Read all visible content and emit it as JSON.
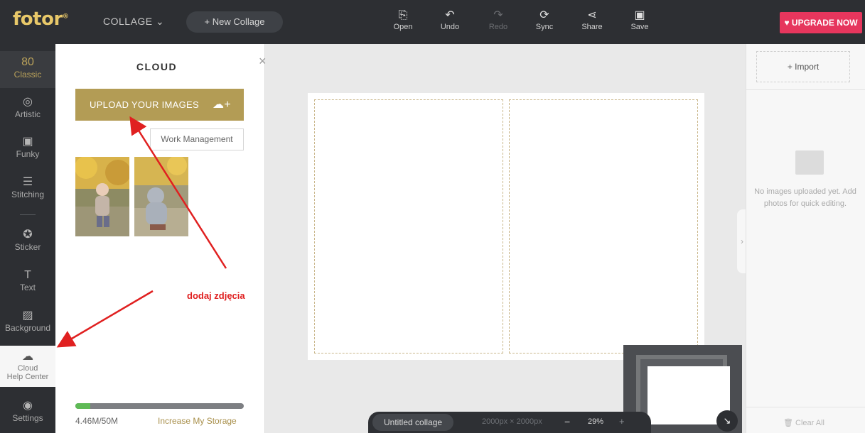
{
  "header": {
    "logo": "fotor",
    "logo_mark": "®",
    "mode_menu": "COLLAGE ⌄",
    "new_collage": "+ New Collage",
    "tools": [
      {
        "label": "Open",
        "icon": "open-icon",
        "glyph": "⎘"
      },
      {
        "label": "Undo",
        "icon": "undo-icon",
        "glyph": "↶"
      },
      {
        "label": "Redo",
        "icon": "redo-icon",
        "glyph": "↷"
      },
      {
        "label": "Sync",
        "icon": "sync-icon",
        "glyph": "⟳"
      },
      {
        "label": "Share",
        "icon": "share-icon",
        "glyph": "⋖"
      },
      {
        "label": "Save",
        "icon": "save-icon",
        "glyph": "▣"
      }
    ],
    "upgrade": "♥ UPGRADE NOW",
    "upgrade_color": "#e6365d"
  },
  "sidebar": {
    "items": [
      {
        "label": "Classic",
        "icon": "classic-icon",
        "glyph": "80"
      },
      {
        "label": "Artistic",
        "icon": "artistic-icon",
        "glyph": "◎"
      },
      {
        "label": "Funky",
        "icon": "funky-icon",
        "glyph": "▣"
      },
      {
        "label": "Stitching",
        "icon": "stitching-icon",
        "glyph": "☰"
      },
      {
        "label": "Sticker",
        "icon": "sticker-icon",
        "glyph": "✪"
      },
      {
        "label": "Text",
        "icon": "text-icon",
        "glyph": "T"
      },
      {
        "label": "Background",
        "icon": "background-icon",
        "glyph": "▨"
      },
      {
        "label": "Cloud",
        "icon": "cloud-icon",
        "glyph": "☁"
      },
      {
        "label": "Help Center",
        "icon": "help-icon",
        "glyph": "?"
      },
      {
        "label": "Settings",
        "icon": "settings-icon",
        "glyph": "◉"
      }
    ]
  },
  "cloud_panel": {
    "title": "CLOUD",
    "close": "×",
    "upload_button": "UPLOAD YOUR IMAGES",
    "upload_icon": "☁+",
    "tooltip": "Work Management",
    "storage_used": "4.46M/50M",
    "storage_fraction": 0.09,
    "increase_storage": "Increase My Storage"
  },
  "right_panel": {
    "import": "+ Import",
    "empty_message": "No images uploaded yet. Add photos for quick editing.",
    "clear_all": "Clear All",
    "clear_icon": "🗑",
    "collapse": "›"
  },
  "status": {
    "doc_name": "Untitled collage",
    "size": "2000px × 2000px",
    "zoom_minus": "−",
    "zoom": "29%",
    "zoom_plus": "+",
    "nav_toggle": "↘"
  },
  "annotation": {
    "text": "dodaj zdjęcia",
    "color": "#e02020"
  },
  "colors": {
    "accent": "#b39c55",
    "topbar": "#2d2f33"
  }
}
